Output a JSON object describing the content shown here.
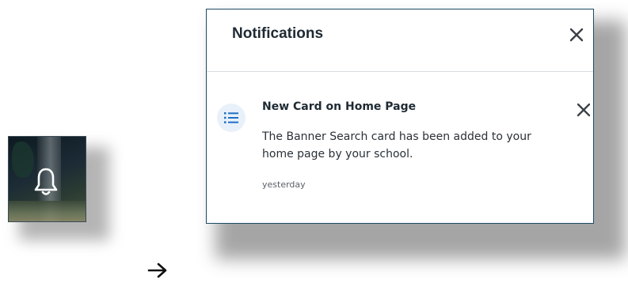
{
  "notifications_panel": {
    "title": "Notifications",
    "items": [
      {
        "title": "New Card on Home Page",
        "body": "The Banner Search card has been added to your home page by your school.",
        "time": "yesterday"
      }
    ]
  },
  "icons": {
    "bell": "bell-icon",
    "arrow": "arrow-right-icon",
    "close": "close-icon",
    "list": "list-icon"
  },
  "colors": {
    "panel_border": "#1e4a63",
    "list_icon": "#1f6fc5",
    "badge_bg": "#e8f1fa"
  }
}
